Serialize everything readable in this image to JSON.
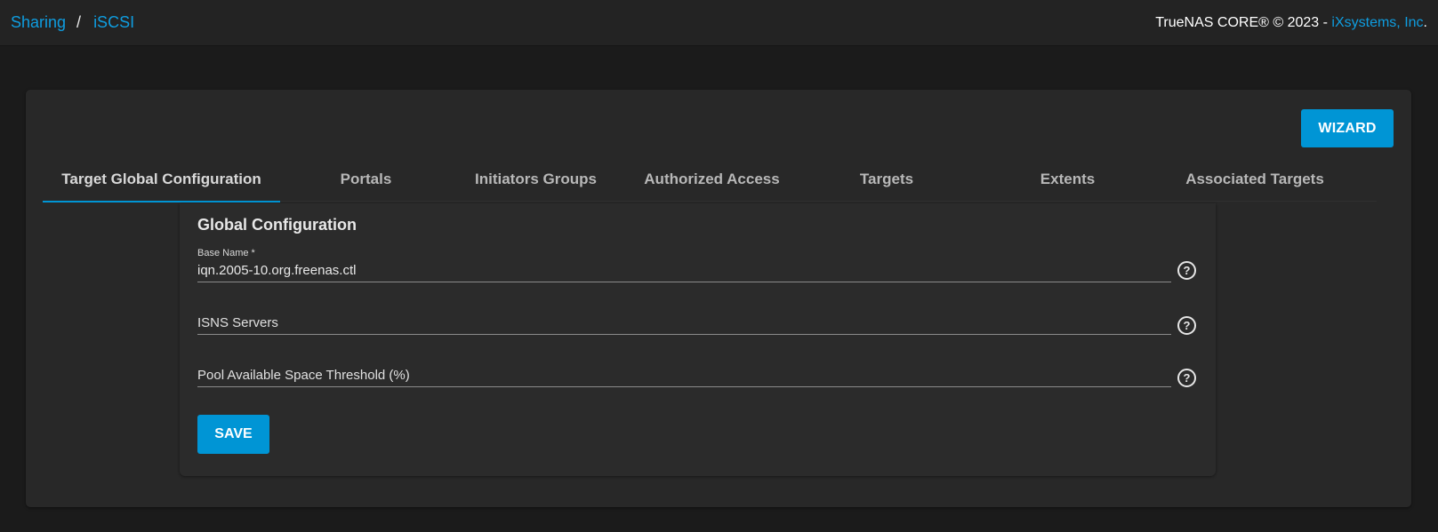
{
  "breadcrumb": {
    "items": [
      "Sharing",
      "iSCSI"
    ],
    "separator": "/"
  },
  "footer": {
    "copyright": "TrueNAS CORE® © 2023 - ",
    "vendor": "iXsystems, Inc",
    "suffix": "."
  },
  "toolbar": {
    "wizard_label": "WIZARD"
  },
  "tabs": [
    {
      "label": "Target Global Configuration",
      "active": true
    },
    {
      "label": "Portals",
      "active": false
    },
    {
      "label": "Initiators Groups",
      "active": false
    },
    {
      "label": "Authorized Access",
      "active": false
    },
    {
      "label": "Targets",
      "active": false
    },
    {
      "label": "Extents",
      "active": false
    },
    {
      "label": "Associated Targets",
      "active": false
    }
  ],
  "form": {
    "title": "Global Configuration",
    "fields": [
      {
        "label": "Base Name *",
        "value": "iqn.2005-10.org.freenas.ctl",
        "placeholder": ""
      },
      {
        "label": "",
        "value": "",
        "placeholder": "ISNS Servers"
      },
      {
        "label": "",
        "value": "",
        "placeholder": "Pool Available Space Threshold (%)"
      }
    ],
    "help_icon": "?",
    "save_label": "SAVE"
  },
  "colors": {
    "accent": "#0095d5",
    "link": "#0f9de0",
    "background": "#1b1b1b",
    "card": "#282828"
  },
  "icons": {
    "help": "help-circle-icon"
  }
}
